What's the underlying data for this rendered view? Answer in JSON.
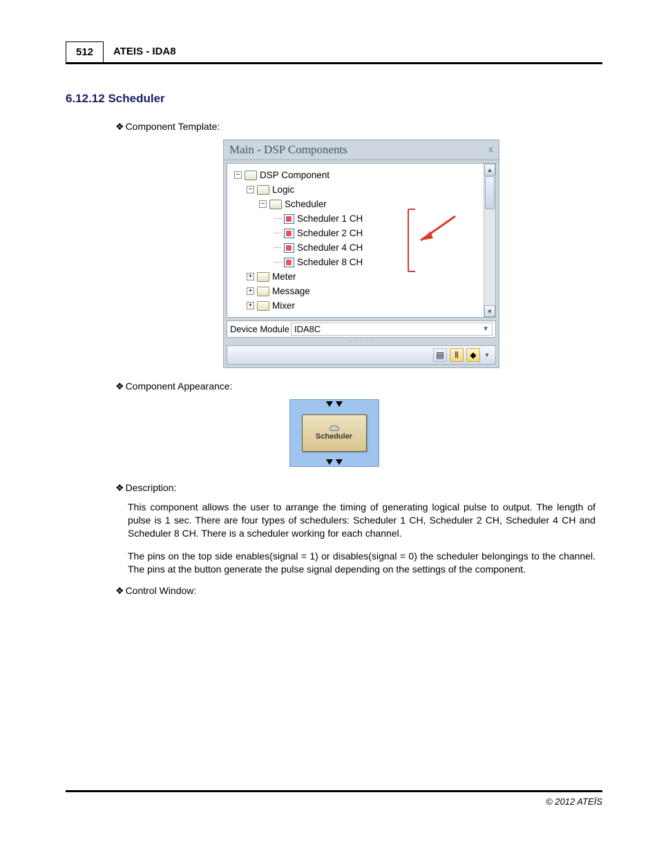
{
  "header": {
    "page_number": "512",
    "doc_title": "ATEIS - IDA8"
  },
  "section": {
    "number": "6.12.12",
    "title": "Scheduler"
  },
  "bullets": {
    "template": "Component Template:",
    "appearance": "Component Appearance:",
    "description": "Description:",
    "control": "Control Window:"
  },
  "panel": {
    "title": "Main - DSP Components",
    "close": "x",
    "tree": {
      "root": "DSP Component",
      "logic": "Logic",
      "scheduler": "Scheduler",
      "sched1": "Scheduler 1 CH",
      "sched2": "Scheduler 2 CH",
      "sched4": "Scheduler 4 CH",
      "sched8": "Scheduler 8 CH",
      "meter": "Meter",
      "message": "Message",
      "mixer": "Mixer"
    },
    "device_label": "Device Module",
    "device_value": "IDA8C"
  },
  "component": {
    "label": "Scheduler"
  },
  "description": {
    "p1": "This component allows the user to arrange the timing of generating logical pulse to output. The length of pulse is 1 sec. There are four types of schedulers: Scheduler 1 CH, Scheduler 2 CH, Scheduler 4 CH and Scheduler 8 CH. There is a scheduler working for each channel.",
    "p2": "The pins on the top side enables(signal = 1) or disables(signal = 0) the scheduler belongings to the channel. The pins at the button generate the pulse signal depending on the settings of the component."
  },
  "footer": "© 2012 ATEÏS"
}
